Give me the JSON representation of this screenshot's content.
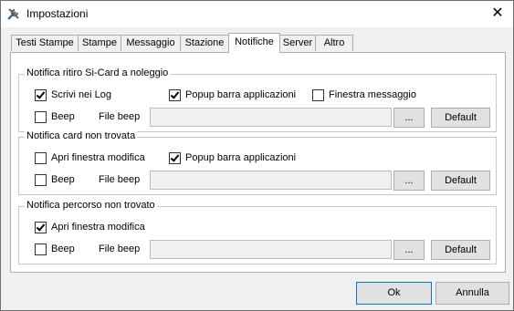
{
  "window": {
    "title": "Impostazioni"
  },
  "tabs": [
    "Testi Stampe",
    "Stampe",
    "Messaggio",
    "Stazione",
    "Notifiche",
    "Server",
    "Altro"
  ],
  "active_tab": "Notifiche",
  "groups": [
    {
      "title": "Notifica ritiro Si-Card a noleggio",
      "checkboxes": [
        {
          "label": "Scrivi nei Log",
          "checked": true
        },
        {
          "label": "Popup barra applicazioni",
          "checked": true
        },
        {
          "label": "Finestra messaggio",
          "checked": false
        }
      ],
      "beep": {
        "label": "Beep",
        "checked": false
      },
      "file_label": "File beep",
      "file_value": "",
      "browse": "...",
      "default": "Default"
    },
    {
      "title": "Notifica card non trovata",
      "checkboxes": [
        {
          "label": "Apri finestra modifica",
          "checked": false
        },
        {
          "label": "Popup barra applicazioni",
          "checked": true
        }
      ],
      "beep": {
        "label": "Beep",
        "checked": false
      },
      "file_label": "File beep",
      "file_value": "",
      "browse": "...",
      "default": "Default"
    },
    {
      "title": "Notifica percorso non trovato",
      "checkboxes": [
        {
          "label": "Apri finestra modifica",
          "checked": true
        }
      ],
      "beep": {
        "label": "Beep",
        "checked": false
      },
      "file_label": "File beep",
      "file_value": "",
      "browse": "...",
      "default": "Default"
    }
  ],
  "buttons": {
    "ok": "Ok",
    "cancel": "Annulla"
  }
}
